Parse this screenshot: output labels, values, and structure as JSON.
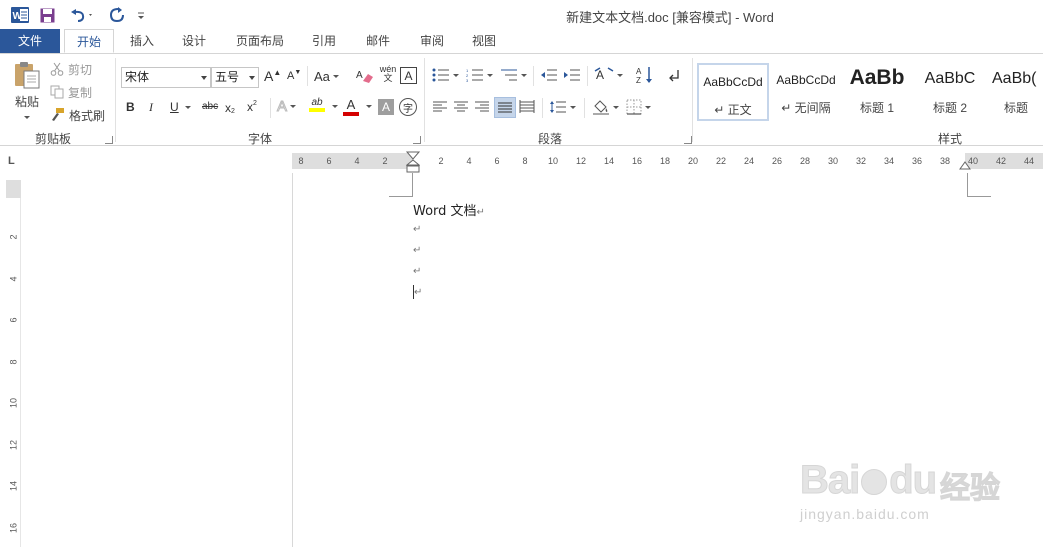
{
  "window": {
    "title": "新建文本文档.doc [兼容模式] - Word"
  },
  "quick_access": {
    "app_icon": "word-icon",
    "save_icon": "save-icon",
    "undo_icon": "undo-icon",
    "redo_icon": "redo-icon",
    "customize_icon": "customize-icon"
  },
  "tabs": [
    {
      "label": "文件"
    },
    {
      "label": "开始"
    },
    {
      "label": "插入"
    },
    {
      "label": "设计"
    },
    {
      "label": "页面布局"
    },
    {
      "label": "引用"
    },
    {
      "label": "邮件"
    },
    {
      "label": "审阅"
    },
    {
      "label": "视图"
    }
  ],
  "clipboard": {
    "group_label": "剪贴板",
    "paste_label": "粘贴",
    "cut_label": "剪切",
    "copy_label": "复制",
    "format_painter_label": "格式刷"
  },
  "font": {
    "group_label": "字体",
    "font_name": "宋体",
    "font_size": "五号",
    "change_case_label": "Aa",
    "phonetic_label": "wén文",
    "enclosed_char": "字",
    "bold": "B",
    "italic": "I",
    "underline": "U",
    "strikethrough": "abc",
    "subscript": "x",
    "subscript_mark": "2",
    "superscript": "x",
    "superscript_mark": "2",
    "grow_label": "A",
    "shrink_label": "A",
    "effects_label": "A",
    "color_label": "A",
    "shading_label": "A",
    "highlight_label": "ab",
    "highlight_color": "#ffff00",
    "font_color": "#d40000"
  },
  "paragraph": {
    "group_label": "段落",
    "sort_label": "A↓Z"
  },
  "styles": {
    "group_label": "样式",
    "items": [
      {
        "sample": "AaBbCcDd",
        "name": "↵ 正文"
      },
      {
        "sample": "AaBbCcDd",
        "name": "↵ 无间隔"
      },
      {
        "sample": "AaBb",
        "name": "标题 1"
      },
      {
        "sample": "AaBbC",
        "name": "标题 2"
      },
      {
        "sample": "AaBb(",
        "name": "标题"
      }
    ]
  },
  "ruler": {
    "corner": "L",
    "h_left_ticks": [
      "8",
      "6",
      "4",
      "2"
    ],
    "h_right_ticks": [
      "2",
      "4",
      "6",
      "8",
      "10",
      "12",
      "14",
      "16",
      "18",
      "20",
      "22",
      "24",
      "26",
      "28",
      "30",
      "32",
      "34",
      "36",
      "38",
      "40",
      "42",
      "44"
    ],
    "v_ticks": [
      "2",
      "4",
      "6",
      "8",
      "10",
      "12",
      "14",
      "16"
    ]
  },
  "document": {
    "lines": [
      "Word 文档",
      "",
      "",
      "",
      ""
    ],
    "para_mark": "↵"
  },
  "watermark": {
    "brand": "Bai",
    "brand2": "du",
    "cn": "经验",
    "url": "jingyan.baidu.com"
  },
  "colors": {
    "accent": "#2b579a"
  }
}
